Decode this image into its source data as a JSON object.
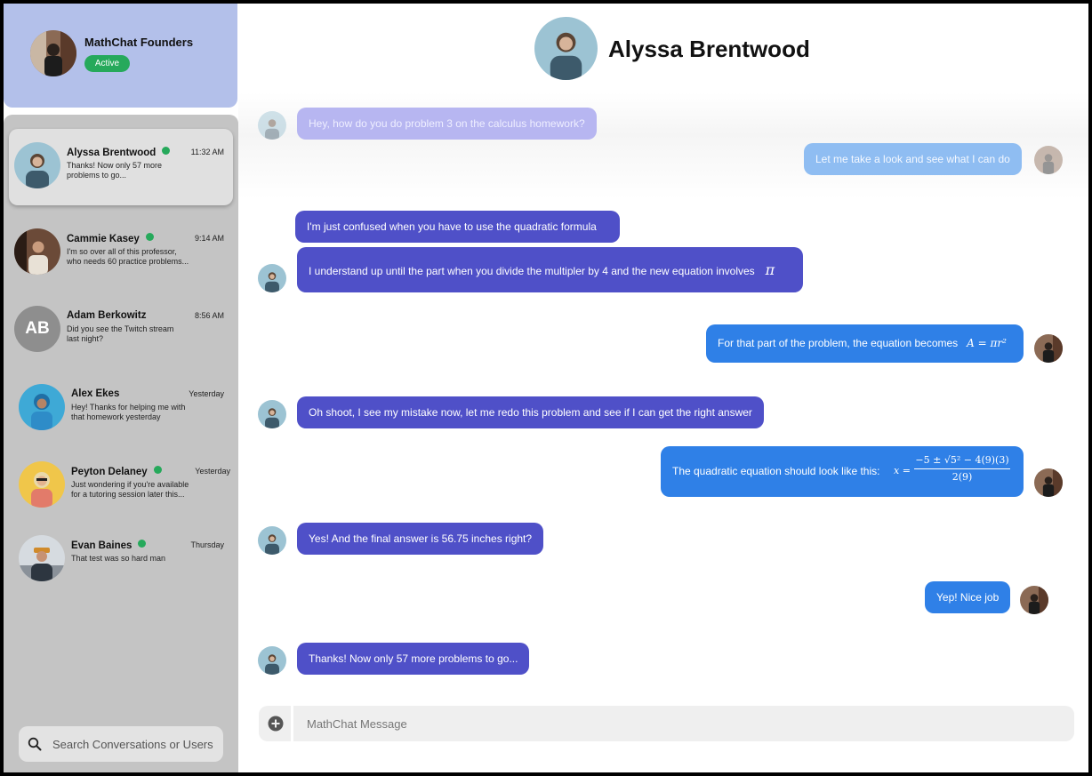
{
  "team": {
    "name": "MathChat Founders",
    "status": "Active"
  },
  "conversations": [
    {
      "name": "Alyssa Brentwood",
      "online": true,
      "time": "11:32 AM",
      "preview": "Thanks! Now only 57 more\nproblems to go..."
    },
    {
      "name": "Cammie Kasey",
      "online": true,
      "time": "9:14 AM",
      "preview": "I'm so over all of this professor,\nwho needs 60 practice problems..."
    },
    {
      "name": "Adam Berkowitz",
      "online": false,
      "initials": "AB",
      "time": "8:56 AM",
      "preview": "Did you see the Twitch stream\nlast night?"
    },
    {
      "name": "Alex Ekes",
      "online": false,
      "time": "Yesterday",
      "preview": "Hey! Thanks for helping me with\nthat homework yesterday"
    },
    {
      "name": "Peyton Delaney",
      "online": true,
      "time": "Yesterday",
      "preview": "Just wondering if you're available\nfor a tutoring session later this..."
    },
    {
      "name": "Evan Baines",
      "online": true,
      "time": "Thursday",
      "preview": "That test was so hard man"
    }
  ],
  "search": {
    "placeholder": "Search Conversations or Users"
  },
  "chat": {
    "title": "Alyssa Brentwood",
    "messages": [
      {
        "dir": "in",
        "text": "Hey, how do you do problem 3 on the calculus homework?"
      },
      {
        "dir": "out",
        "text": "Let me take a look and see what I can do"
      },
      {
        "dir": "in",
        "text": "I'm just confused when you have to use the quadratic formula"
      },
      {
        "dir": "in",
        "text": "I understand up until the part when you divide the multipler by 4 and the new equation involves",
        "math": "π"
      },
      {
        "dir": "out",
        "text": "For that part of the problem, the equation becomes",
        "math": "A = πr²"
      },
      {
        "dir": "in",
        "text": "Oh shoot, I see my mistake now, let me redo this problem and see if I can get the right answer"
      },
      {
        "dir": "out",
        "text": "The quadratic equation should look like this:",
        "math_numerator": "−5 ± √5² − 4(9)(3)",
        "math_denominator": "2(9)",
        "math_lhs": "x ="
      },
      {
        "dir": "in",
        "text": "Yes! And the final answer is 56.75 inches right?"
      },
      {
        "dir": "out",
        "text": "Yep! Nice job"
      },
      {
        "dir": "in",
        "text": "Thanks! Now only 57 more problems to go..."
      }
    ]
  },
  "composer": {
    "placeholder": "MathChat Message"
  },
  "colors": {
    "incoming": "#4f50c8",
    "outgoing": "#2f80e7",
    "online": "#26a95b",
    "team_card": "#b3c0ea",
    "sidebar": "#c4c4c4"
  }
}
